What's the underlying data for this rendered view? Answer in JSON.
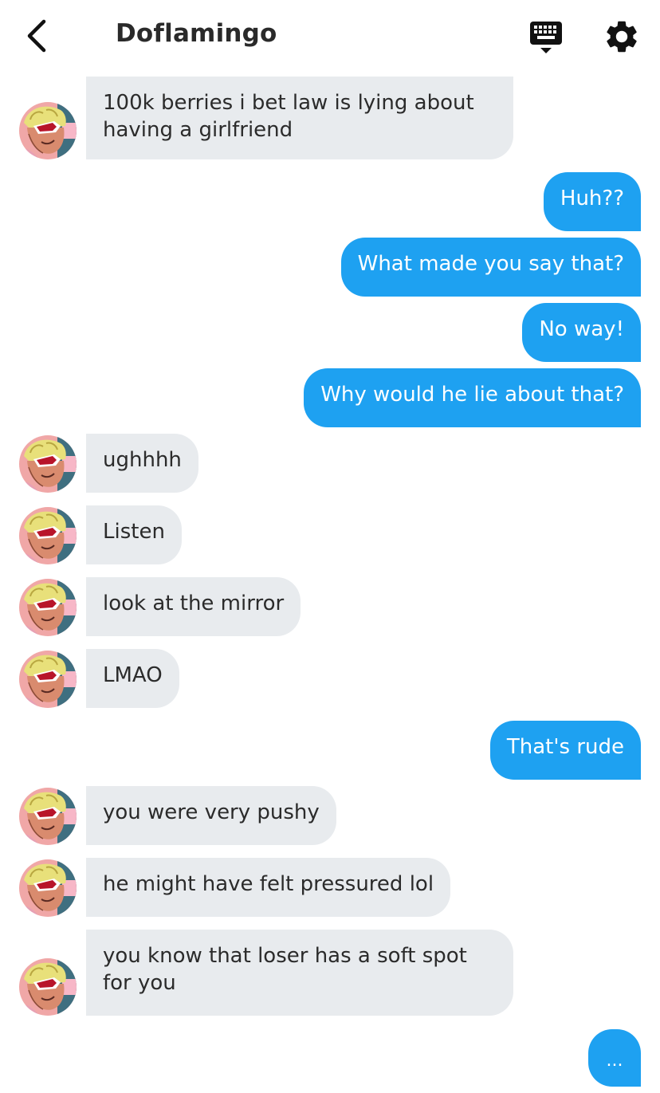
{
  "header": {
    "title": "Doflamingo",
    "back_icon": "chevron-left-icon",
    "keyboard_icon": "keyboard-icon",
    "settings_icon": "gear-icon"
  },
  "colors": {
    "outgoing_bubble": "#1ea1f1",
    "incoming_bubble": "#e8ebee",
    "background": "#ffffff"
  },
  "messages": [
    {
      "from": "doflamingo",
      "text": "100k berries i bet law is lying about having a girlfriend"
    },
    {
      "from": "me",
      "text": "Huh??"
    },
    {
      "from": "me",
      "text": "What made you say that?"
    },
    {
      "from": "me",
      "text": "No way!"
    },
    {
      "from": "me",
      "text": "Why would he lie about that?"
    },
    {
      "from": "doflamingo",
      "text": "ughhhh"
    },
    {
      "from": "doflamingo",
      "text": "Listen"
    },
    {
      "from": "doflamingo",
      "text": "look at the mirror"
    },
    {
      "from": "doflamingo",
      "text": "LMAO"
    },
    {
      "from": "me",
      "text": "That's rude"
    },
    {
      "from": "doflamingo",
      "text": "you were very pushy"
    },
    {
      "from": "doflamingo",
      "text": "he might have felt pressured lol"
    },
    {
      "from": "doflamingo",
      "text": "you know that loser has a soft spot for you"
    }
  ],
  "typing_indicator": "..."
}
